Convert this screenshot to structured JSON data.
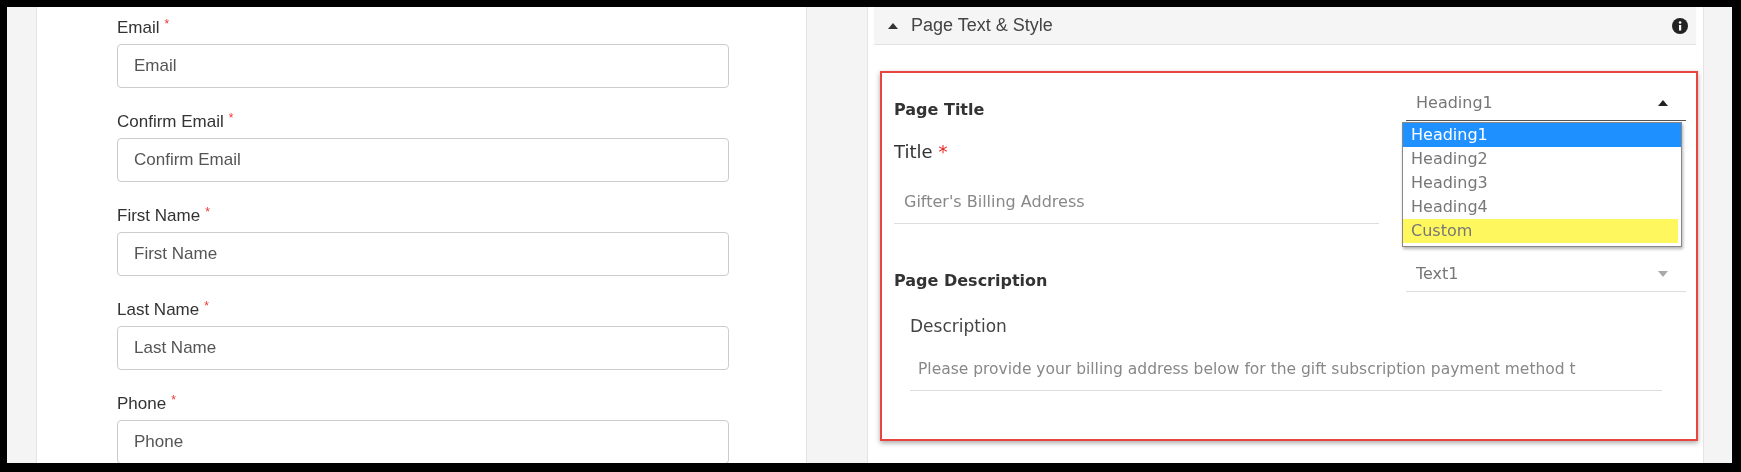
{
  "form": {
    "fields": [
      {
        "label": "Email",
        "required_mark": "*",
        "placeholder": "Email"
      },
      {
        "label": "Confirm Email",
        "required_mark": "*",
        "placeholder": "Confirm Email"
      },
      {
        "label": "First Name",
        "required_mark": "*",
        "placeholder": "First Name"
      },
      {
        "label": "Last Name",
        "required_mark": "*",
        "placeholder": "Last Name"
      },
      {
        "label": "Phone",
        "required_mark": "*",
        "placeholder": "Phone"
      }
    ]
  },
  "panel": {
    "title": "Page Text & Style",
    "expanded": true,
    "page_title": {
      "heading": "Page Title",
      "style_select": {
        "value": "Heading1",
        "open": true,
        "options": [
          {
            "label": "Heading1",
            "selected": true,
            "highlighted": false
          },
          {
            "label": "Heading2",
            "selected": false,
            "highlighted": false
          },
          {
            "label": "Heading3",
            "selected": false,
            "highlighted": false
          },
          {
            "label": "Heading4",
            "selected": false,
            "highlighted": false
          },
          {
            "label": "Custom",
            "selected": false,
            "highlighted": true
          }
        ]
      },
      "field_label": "Title",
      "required_mark": "*",
      "value": "Gifter's Billing Address"
    },
    "page_description": {
      "heading": "Page Description",
      "style_select": {
        "value": "Text1",
        "open": false
      },
      "field_label": "Description",
      "value": "Please provide your billing address below for the gift subscription payment method t"
    }
  }
}
